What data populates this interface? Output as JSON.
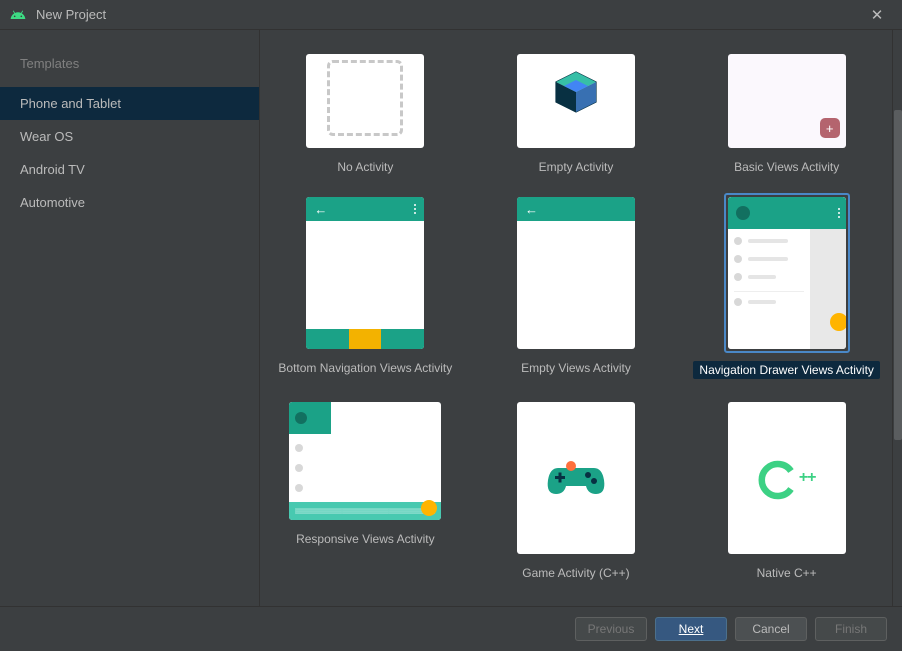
{
  "title": "New Project",
  "sidebar": {
    "header": "Templates",
    "items": [
      {
        "label": "Phone and Tablet",
        "selected": true
      },
      {
        "label": "Wear OS",
        "selected": false
      },
      {
        "label": "Android TV",
        "selected": false
      },
      {
        "label": "Automotive",
        "selected": false
      }
    ]
  },
  "templates": {
    "row1": [
      {
        "label": "No Activity"
      },
      {
        "label": "Empty Activity"
      },
      {
        "label": "Basic Views Activity"
      }
    ],
    "row2": [
      {
        "label": "Bottom Navigation Views Activity"
      },
      {
        "label": "Empty Views Activity"
      },
      {
        "label": "Navigation Drawer Views Activity",
        "selected": true
      }
    ],
    "row3": [
      {
        "label": "Responsive Views Activity"
      },
      {
        "label": "Game Activity (C++)"
      },
      {
        "label": "Native C++"
      }
    ]
  },
  "footer": {
    "previous": "Previous",
    "next": "Next",
    "cancel": "Cancel",
    "finish": "Finish"
  }
}
